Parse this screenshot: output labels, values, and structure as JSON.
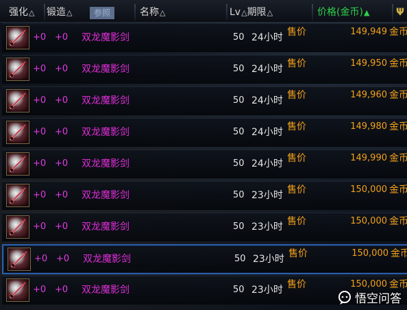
{
  "header": {
    "enhance": "强化",
    "forge": "锻造",
    "selected_tab": "参照",
    "name": "名称",
    "lv": "Lv",
    "duration": "期限",
    "price": "价格(金币)",
    "sort_asc_symbol": "△",
    "sort_active_symbol": "▲"
  },
  "rows": [
    {
      "enhance": "+0",
      "forge": "+0",
      "name": "双龙魔影剑",
      "lv": "50",
      "duration": "24小时",
      "price_label": "售价",
      "price": "149,949",
      "currency": "金币"
    },
    {
      "enhance": "+0",
      "forge": "+0",
      "name": "双龙魔影剑",
      "lv": "50",
      "duration": "24小时",
      "price_label": "售价",
      "price": "149,950",
      "currency": "金币"
    },
    {
      "enhance": "+0",
      "forge": "+0",
      "name": "双龙魔影剑",
      "lv": "50",
      "duration": "24小时",
      "price_label": "售价",
      "price": "149,960",
      "currency": "金币"
    },
    {
      "enhance": "+0",
      "forge": "+0",
      "name": "双龙魔影剑",
      "lv": "50",
      "duration": "24小时",
      "price_label": "售价",
      "price": "149,980",
      "currency": "金币"
    },
    {
      "enhance": "+0",
      "forge": "+0",
      "name": "双龙魔影剑",
      "lv": "50",
      "duration": "24小时",
      "price_label": "售价",
      "price": "149,990",
      "currency": "金币"
    },
    {
      "enhance": "+0",
      "forge": "+0",
      "name": "双龙魔影剑",
      "lv": "50",
      "duration": "23小时",
      "price_label": "售价",
      "price": "150,000",
      "currency": "金币"
    },
    {
      "enhance": "+0",
      "forge": "+0",
      "name": "双龙魔影剑",
      "lv": "50",
      "duration": "23小时",
      "price_label": "售价",
      "price": "150,000",
      "currency": "金币"
    },
    {
      "enhance": "+0",
      "forge": "+0",
      "name": "双龙魔影剑",
      "lv": "50",
      "duration": "23小时",
      "price_label": "售价",
      "price": "150,000",
      "currency": "金币"
    },
    {
      "enhance": "+0",
      "forge": "+0",
      "name": "双龙魔影剑",
      "lv": "50",
      "duration": "23小时",
      "price_label": "售价",
      "price": "150,000",
      "currency": "金币"
    }
  ],
  "selected_row_index": 7,
  "item_icon": "sword-icon",
  "watermark": {
    "icon": "chat-bubble-logo-icon",
    "text": "悟空问答"
  },
  "colors": {
    "item_name": "#df2ed8",
    "price": "#f4a11a",
    "price_header": "#2fd24a",
    "selection_border": "#2b5fae"
  }
}
